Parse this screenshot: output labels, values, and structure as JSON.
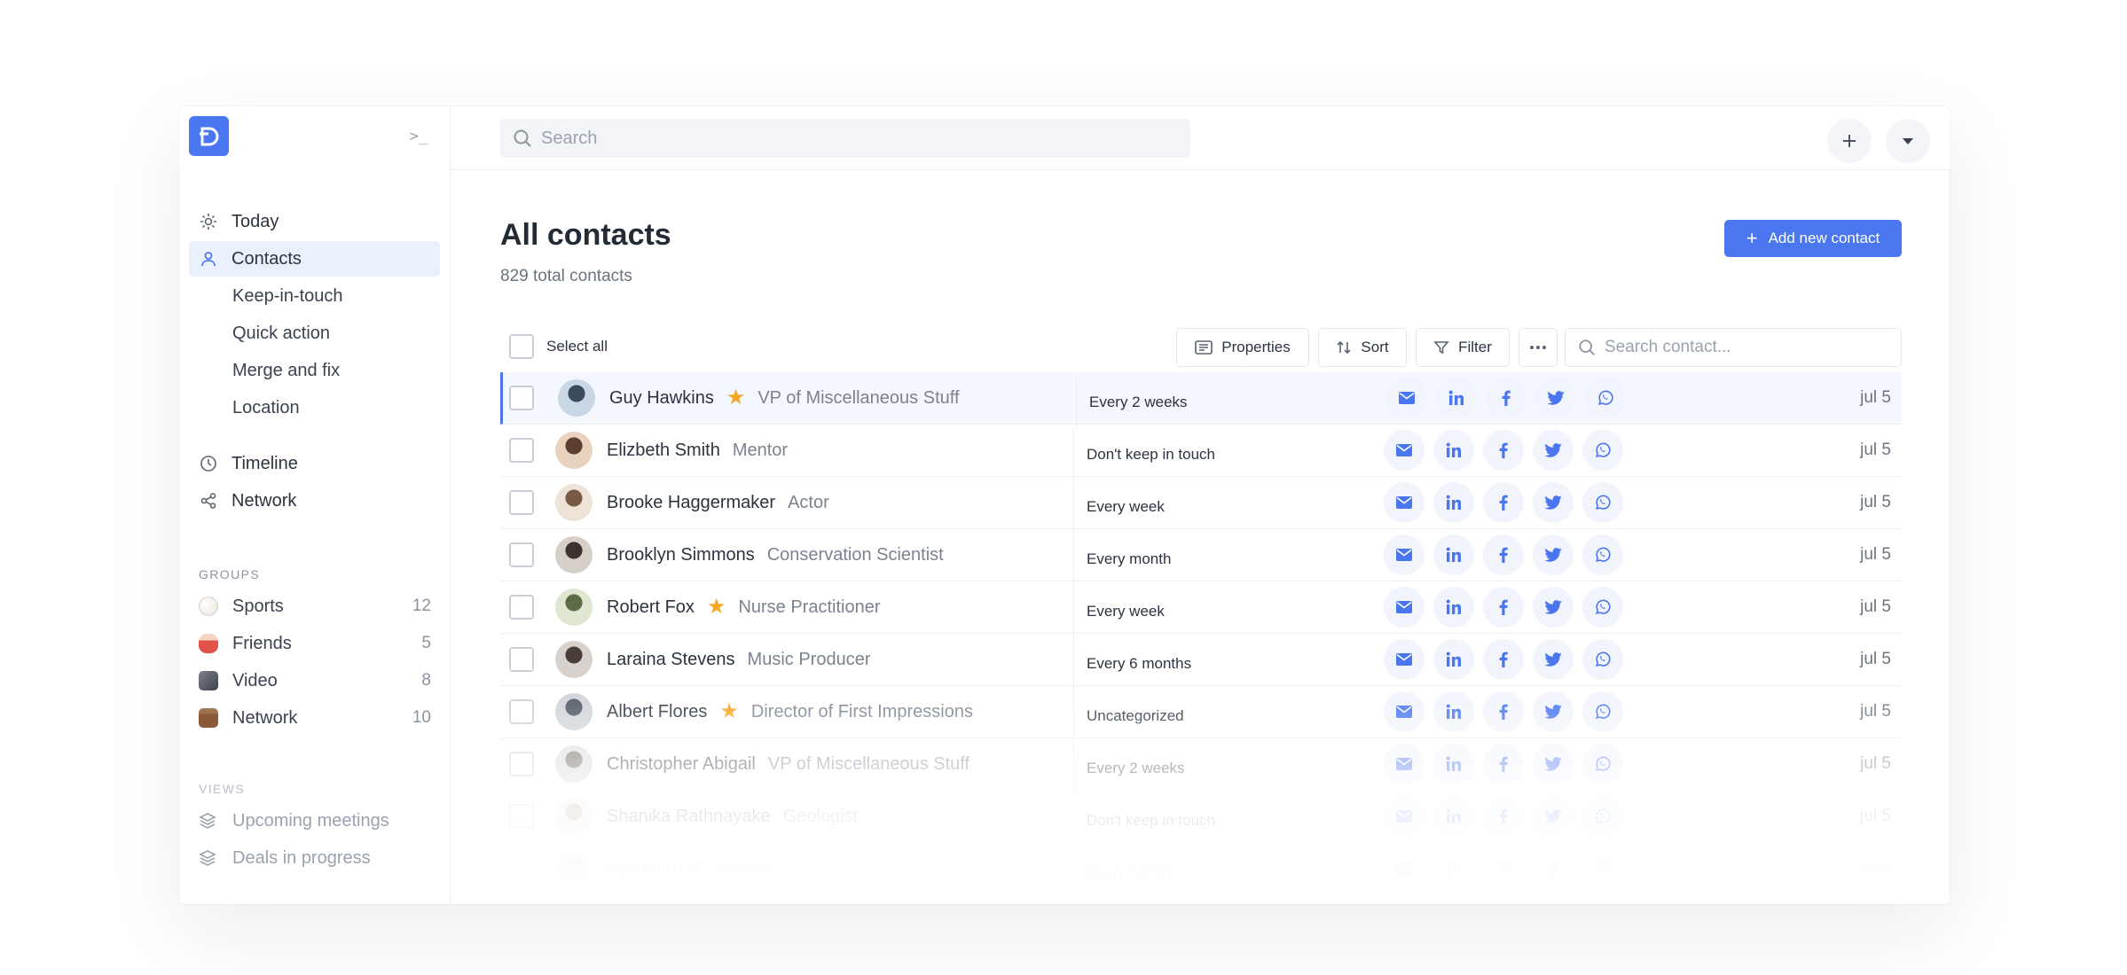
{
  "search": {
    "placeholder": "Search"
  },
  "sidebar": {
    "nav": [
      {
        "label": "Today",
        "icon": "sun-icon"
      },
      {
        "label": "Contacts",
        "icon": "user-icon",
        "active": true
      }
    ],
    "contacts_sub": [
      "Keep-in-touch",
      "Quick action",
      "Merge and fix",
      "Location"
    ],
    "nav2": [
      {
        "label": "Timeline",
        "icon": "clock-icon"
      },
      {
        "label": "Network",
        "icon": "share-icon"
      }
    ],
    "groups_label": "GROUPS",
    "groups": [
      {
        "label": "Sports",
        "count": "12",
        "icon": "baseball-icon"
      },
      {
        "label": "Friends",
        "count": "5",
        "icon": "drum-icon"
      },
      {
        "label": "Video",
        "count": "8",
        "icon": "camera-icon"
      },
      {
        "label": "Network",
        "count": "10",
        "icon": "briefcase-icon"
      }
    ],
    "views_label": "VIEWS",
    "views": [
      "Upcoming meetings",
      "Deals in progress"
    ]
  },
  "page": {
    "title": "All contacts",
    "subtitle": "829 total contacts",
    "add_button": "Add new contact"
  },
  "toolbar": {
    "select_all": "Select all",
    "properties": "Properties",
    "sort": "Sort",
    "filter": "Filter",
    "search_placeholder": "Search contact..."
  },
  "contacts": [
    {
      "name": "Guy Hawkins",
      "starred": true,
      "role": "VP of Miscellaneous Stuff",
      "frequency": "Every 2 weeks",
      "date": "jul 5"
    },
    {
      "name": "Elizbeth Smith",
      "starred": false,
      "role": "Mentor",
      "frequency": "Don't keep in touch",
      "date": "jul 5"
    },
    {
      "name": "Brooke Haggermaker",
      "starred": false,
      "role": "Actor",
      "frequency": "Every week",
      "date": "jul 5"
    },
    {
      "name": "Brooklyn Simmons",
      "starred": false,
      "role": "Conservation Scientist",
      "frequency": "Every month",
      "date": "jul 5"
    },
    {
      "name": "Robert Fox",
      "starred": true,
      "role": "Nurse Practitioner",
      "frequency": "Every week",
      "date": "jul 5"
    },
    {
      "name": "Laraina Stevens",
      "starred": false,
      "role": "Music Producer",
      "frequency": "Every 6 months",
      "date": "jul 5"
    },
    {
      "name": "Albert Flores",
      "starred": true,
      "role": "Director of First Impressions",
      "frequency": "Uncategorized",
      "date": "jul 5"
    },
    {
      "name": "Christopher Abigail",
      "starred": false,
      "role": "VP of Miscellaneous Stuff",
      "frequency": "Every 2 weeks",
      "date": "jul 5"
    },
    {
      "name": "Shanika Rathnayake",
      "starred": false,
      "role": "Geologist",
      "frequency": "Don't keep in touch",
      "date": "jul 5"
    },
    {
      "name": "Hyo Hartzel",
      "starred": false,
      "role": "Investor",
      "frequency": "Every month",
      "date": "jul 5"
    }
  ],
  "colors": {
    "accent": "#4a76f0",
    "star": "#f5a623",
    "selected_row": "#f4f7fe"
  }
}
